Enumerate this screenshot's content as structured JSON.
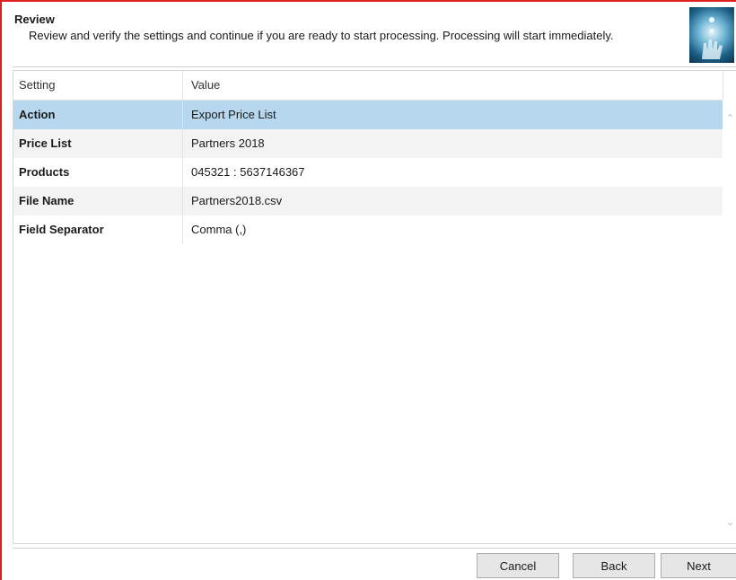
{
  "header": {
    "title": "Review",
    "description": "Review and verify the settings and continue if you are ready to start processing. Processing will start immediately.",
    "logo_icon": "wizard-hand-icon"
  },
  "grid": {
    "columns": [
      "Setting",
      "Value"
    ],
    "rows": [
      {
        "setting": "Action",
        "value": "Export Price List",
        "selected": true
      },
      {
        "setting": "Price List",
        "value": "Partners 2018",
        "selected": false
      },
      {
        "setting": "Products",
        "value": "045321 : 5637146367",
        "selected": false
      },
      {
        "setting": "File Name",
        "value": "Partners2018.csv",
        "selected": false
      },
      {
        "setting": "Field Separator",
        "value": "Comma (,)",
        "selected": false
      }
    ]
  },
  "buttons": {
    "cancel": "Cancel",
    "back": "Back",
    "next": "Next"
  },
  "colors": {
    "selection": "#b6d7ee",
    "frame": "#e02020"
  }
}
